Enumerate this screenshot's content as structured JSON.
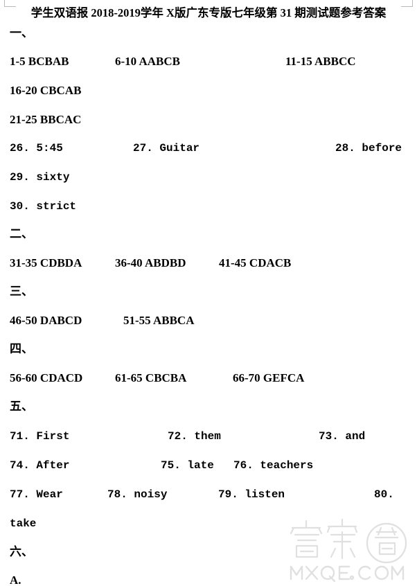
{
  "document": {
    "title": "学生双语报 2018-2019学年 X版广东专版七年级第 31 期测试题参考答案",
    "background_color": "#ffffff",
    "text_color": "#000000"
  },
  "sections": {
    "one": "一、",
    "two": "二、",
    "three": "三、",
    "four": "四、",
    "five": "五、",
    "six": "六、"
  },
  "answers": {
    "r1_5": "1-5 BCBAB",
    "r6_10": "6-10 AABCB",
    "r11_15": "11-15 ABBCC",
    "r16_20": "16-20 CBCAB",
    "r21_25": "21-25 BBCAC",
    "q26": "26. 5:45",
    "q27": "27. Guitar",
    "q28": "28. before",
    "q29": "29. sixty",
    "q30": "30. strict",
    "r31_35": "31-35 CDBDA",
    "r36_40": "36-40 ABDBD",
    "r41_45": "41-45 CDACB",
    "r46_50": "46-50 DABCD",
    "r51_55": "51-55 ABBCA",
    "r56_60": "56-60 CDACD",
    "r61_65": "61-65 CBCBA",
    "r66_70": "66-70 GEFCA",
    "q71": "71. First",
    "q72": "72. them",
    "q73": "73. and",
    "q74": "74. After",
    "q75": "75. late",
    "q76": "76. teachers",
    "q77": "77. Wear",
    "q78": "78. noisy",
    "q79": "79. listen",
    "q80_num": "80.",
    "q80_word": "take",
    "part_a": "A."
  },
  "watermark": {
    "logo_text": "答案卷",
    "site_text": "MXQE.COM",
    "color": "#e2e2e2"
  }
}
